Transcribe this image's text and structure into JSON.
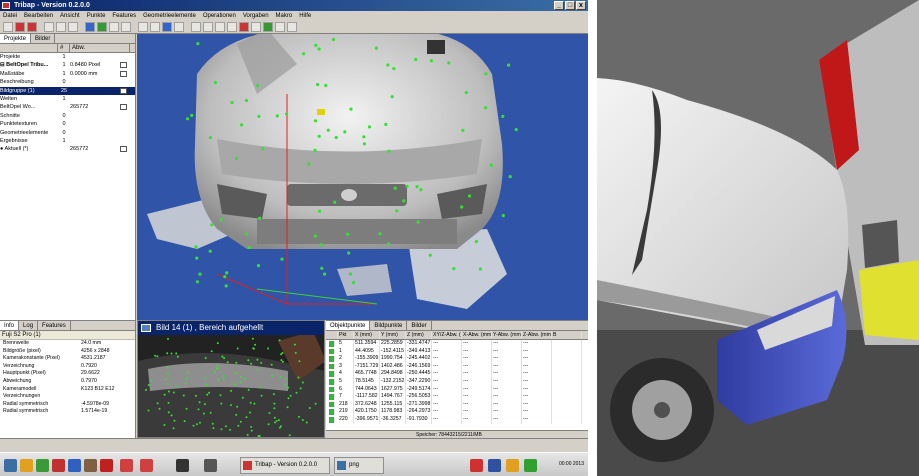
{
  "app": {
    "title": "Tribap - Version 0.2.0.0",
    "window_buttons": [
      "_",
      "□",
      "x"
    ],
    "menu": [
      "Datei",
      "Bearbeiten",
      "Ansicht",
      "Punkte",
      "Features",
      "Geometrieelemente",
      "Operationen",
      "Vorgaben",
      "Makro",
      "Hilfe"
    ]
  },
  "project_panel": {
    "tabs": [
      "Projekte",
      "Bilder"
    ],
    "columns": [
      "",
      "#",
      "Abw."
    ],
    "rows": [
      {
        "name": "Projekte",
        "value": "1",
        "extra": "",
        "check": false,
        "bold": false,
        "selected": false
      },
      {
        "name": "⊟ BeltOpel Tribu...",
        "value": "1",
        "extra": "0.8480 Pixel",
        "check": true,
        "bold": true,
        "selected": false
      },
      {
        "name": "  Maßstäbe",
        "value": "1",
        "extra": "0.0000 mm",
        "check": true,
        "bold": false,
        "selected": false
      },
      {
        "name": "  Beschreibung",
        "value": "0",
        "extra": "",
        "check": false,
        "bold": false,
        "selected": false
      },
      {
        "name": "  Bildgruppe (1)",
        "value": "25",
        "extra": "",
        "check": true,
        "bold": false,
        "selected": true
      },
      {
        "name": "Welten",
        "value": "1",
        "extra": "",
        "check": false,
        "bold": false,
        "selected": false
      },
      {
        "name": "  BeltOpel Wo...",
        "value": "",
        "extra": "265772",
        "check": true,
        "bold": false,
        "selected": false
      },
      {
        "name": "Schnitte",
        "value": "0",
        "extra": "",
        "check": false,
        "bold": false,
        "selected": false
      },
      {
        "name": "Punktetexturen",
        "value": "0",
        "extra": "",
        "check": false,
        "bold": false,
        "selected": false
      },
      {
        "name": "Geometrieelemente",
        "value": "0",
        "extra": "",
        "check": false,
        "bold": false,
        "selected": false
      },
      {
        "name": "Ergebnisse",
        "value": "1",
        "extra": "",
        "check": false,
        "bold": false,
        "selected": false
      },
      {
        "name": "  ● Aktuell (*)",
        "value": "",
        "extra": "265772",
        "check": true,
        "bold": false,
        "selected": false
      }
    ]
  },
  "properties_panel": {
    "tabs": [
      "Info",
      "Log",
      "Features"
    ],
    "header": "Fuji S2 Pro (1)",
    "rows": [
      {
        "k": "Brennweite",
        "v": "24.0 mm"
      },
      {
        "k": "Bildgröße (pixel)",
        "v": "4256 x 2848"
      },
      {
        "k": "Kamerakonstante (Pixel)",
        "v": "4531.2187"
      },
      {
        "k": "Verzeichnung",
        "v": "0.7920"
      },
      {
        "k": "Hauptpunkt (Pixel)",
        "v": "29.6622"
      },
      {
        "k": "Abweichung",
        "v": "0.7970"
      },
      {
        "k": "Kameramodell",
        "v": "K123 B12 E12"
      },
      {
        "k": "Verzeichnungen",
        "v": ""
      },
      {
        "k": "Radial symmetrisch",
        "v": "-4.5978e-09"
      },
      {
        "k": "Radial symmetrisch",
        "v": "1.5714e-19"
      }
    ]
  },
  "image_view": {
    "header": "Bild 14 (1) , Bereich aufgehellt"
  },
  "points_panel": {
    "tabs": [
      "Objektpunkte",
      "Bildpunkte",
      "Bilder"
    ],
    "columns": [
      "",
      "Pkt",
      "X (mm)",
      "Y (mm)",
      "Z (mm)",
      "XY/Z-Abw. (mm)",
      "X-Abw. (mm)",
      "Y-Abw. (mm)",
      "Z-Abw. (mm)",
      "B"
    ],
    "rows": [
      [
        "",
        "5",
        "511.3594",
        "225.2859",
        "-331.4747",
        "---",
        "---",
        "---",
        "---",
        ""
      ],
      [
        "",
        "1",
        "44.4095",
        "-152.4115",
        "-349.4413",
        "---",
        "---",
        "---",
        "---",
        ""
      ],
      [
        "",
        "2",
        "-155.3909",
        "1990.754",
        "-245.4402",
        "---",
        "---",
        "---",
        "---",
        ""
      ],
      [
        "",
        "3",
        "-7151.729",
        "1402.486",
        "-246.1569",
        "---",
        "---",
        "---",
        "---",
        ""
      ],
      [
        "",
        "4",
        "465.7748",
        "294.8498",
        "-250.4445",
        "---",
        "---",
        "---",
        "---",
        ""
      ],
      [
        "",
        "5",
        "78.5145",
        "-132.2152",
        "-347.2290",
        "---",
        "---",
        "---",
        "---",
        ""
      ],
      [
        "",
        "6",
        "744.0643",
        "1627.975",
        "-249.5174",
        "---",
        "---",
        "---",
        "---",
        ""
      ],
      [
        "",
        "7",
        "-1117.582",
        "1494.767",
        "-256.5053",
        "---",
        "---",
        "---",
        "---",
        ""
      ],
      [
        "",
        "218",
        "372.6248",
        "1255.115",
        "-271.3998",
        "---",
        "---",
        "---",
        "---",
        ""
      ],
      [
        "",
        "219",
        "420.1750",
        "1178.983",
        "-264.2973",
        "---",
        "---",
        "---",
        "---",
        ""
      ],
      [
        "",
        "220",
        "-396.9571",
        "-36.3257",
        "-91.7930",
        "---",
        "---",
        "---",
        "---",
        ""
      ]
    ],
    "status": "Speicher: 78443215/2211/MB"
  },
  "taskbar": {
    "task_label": "Tribap - Version 0.2.0.0",
    "task2_label": "png",
    "clock": "00:00 2013"
  }
}
